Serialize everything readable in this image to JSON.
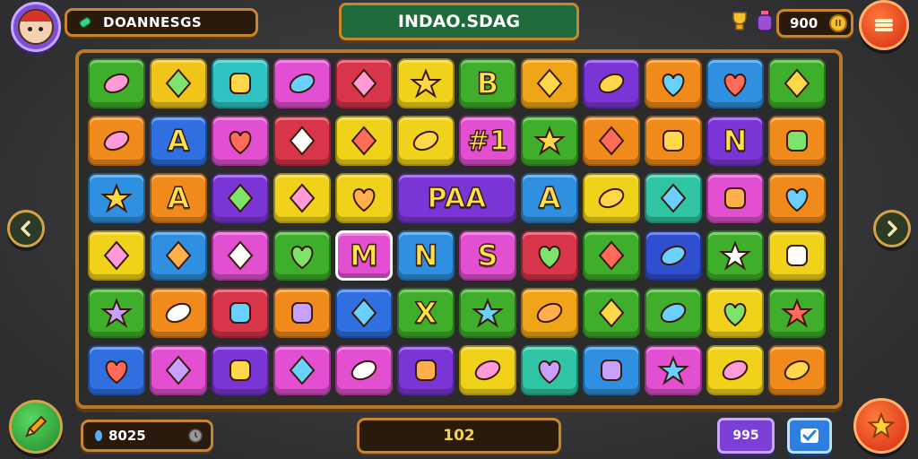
{
  "header": {
    "player_name": "DOANNESGS",
    "title": "INDAO.SDAG",
    "coins": "900"
  },
  "footer": {
    "score": "8025",
    "moves": "102",
    "counter": "995"
  },
  "colors": {
    "board_frame": "#b8782a",
    "title_green": "#1f6a3a",
    "accent_orange": "#d52a12"
  },
  "board": {
    "rows": [
      [
        {
          "color": "#3fae2a",
          "icon": "arrow-cursor-icon"
        },
        {
          "color": "#f0c419",
          "icon": "paintbrush-icon"
        },
        {
          "color": "#2fc4c4",
          "icon": "cupcake-icon"
        },
        {
          "color": "#e24fd0",
          "icon": "jar-icon"
        },
        {
          "color": "#d8344a",
          "icon": "tv-icon"
        },
        {
          "color": "#f0d21a",
          "icon": "heart-candy-icon"
        },
        {
          "color": "#3fae2a",
          "glyph": "B"
        },
        {
          "color": "#f0a418",
          "icon": "cup-icon"
        },
        {
          "color": "#7b35d6",
          "icon": "magnifier-icon"
        },
        {
          "color": "#f08a1a",
          "icon": "x-cross-icon"
        },
        {
          "color": "#2f8fe0",
          "icon": "cloud-candy-icon"
        },
        {
          "color": "#3fae2a",
          "icon": "croissant-icon"
        }
      ],
      [
        {
          "color": "#f08a1a",
          "icon": "oval-candy-icon"
        },
        {
          "color": "#2f6fe0",
          "glyph": "A"
        },
        {
          "color": "#e24fd0",
          "icon": "tack-icon"
        },
        {
          "color": "#d8344a",
          "icon": "fish-icon"
        },
        {
          "color": "#f0d21a",
          "icon": "gem-green-icon"
        },
        {
          "color": "#f0d21a",
          "icon": "leaf-icon"
        },
        {
          "color": "#e24fd0",
          "glyph": "#1"
        },
        {
          "color": "#3fae2a",
          "icon": "crayon-icon"
        },
        {
          "color": "#f08a1a",
          "icon": "roll-icon"
        },
        {
          "color": "#f08a1a",
          "icon": "steak-icon"
        },
        {
          "color": "#7b35d6",
          "glyph": "N"
        },
        {
          "color": "#f08a1a",
          "icon": "bone-icon"
        }
      ],
      [
        {
          "color": "#2f8fe0",
          "icon": "x-wrench-icon"
        },
        {
          "color": "#f08a1a",
          "glyph": "A"
        },
        {
          "color": "#7b35d6",
          "icon": "bell-pepper-icon"
        },
        {
          "color": "#f0d21a",
          "icon": "pepper-icon"
        },
        {
          "color": "#f0d21a",
          "icon": "swirl-icon"
        },
        {
          "color": "#7b35d6",
          "glyph": "PAA",
          "wide": true
        },
        {
          "color": "#2f8fe0",
          "glyph": "A"
        },
        {
          "color": "#f0d21a",
          "icon": "eggplant-icon"
        },
        {
          "color": "#2fc4a4",
          "icon": "carrot-icon"
        },
        {
          "color": "#e24fd0",
          "icon": "star-yellow-icon"
        },
        {
          "color": "#f08a1a",
          "icon": "sausage-icon"
        }
      ],
      [
        {
          "color": "#f0d21a",
          "icon": "apple-icon"
        },
        {
          "color": "#2f8fe0",
          "icon": "icecream-icon"
        },
        {
          "color": "#e24fd0",
          "icon": "gingerbread-icon"
        },
        {
          "color": "#3fae2a",
          "icon": "diamond-icon"
        },
        {
          "color": "#e24fd0",
          "glyph": "M",
          "selected": true
        },
        {
          "color": "#2f8fe0",
          "glyph": "N"
        },
        {
          "color": "#e24fd0",
          "glyph": "S"
        },
        {
          "color": "#d8344a",
          "icon": "leaf-green-icon"
        },
        {
          "color": "#3fae2a",
          "icon": "banana-icon"
        },
        {
          "color": "#2f4fd0",
          "icon": "purple-pepper-icon"
        },
        {
          "color": "#3fae2a",
          "icon": "horseshoe-icon"
        },
        {
          "color": "#f0d21a",
          "icon": "cake-icon"
        }
      ],
      [
        {
          "color": "#3fae2a",
          "icon": "star-orange-icon"
        },
        {
          "color": "#f08a1a",
          "icon": "ring-icon"
        },
        {
          "color": "#d8344a",
          "icon": "star-gold-icon"
        },
        {
          "color": "#f08a1a",
          "icon": "chili-icon"
        },
        {
          "color": "#2f6fe0",
          "icon": "horn-icon"
        },
        {
          "color": "#3fae2a",
          "glyph": "X"
        },
        {
          "color": "#3fae2a",
          "icon": "lock-icon"
        },
        {
          "color": "#f0a418",
          "icon": "drop-icon"
        },
        {
          "color": "#3fae2a",
          "icon": "star-red-icon"
        },
        {
          "color": "#3fae2a",
          "icon": "avocado-icon"
        },
        {
          "color": "#f0d21a",
          "icon": "plum-icon"
        },
        {
          "color": "#3fae2a",
          "icon": "gift-tag-icon"
        }
      ],
      [
        {
          "color": "#2f6fe0",
          "icon": "y-shape-icon"
        },
        {
          "color": "#e24fd0",
          "icon": "leaf-big-icon"
        },
        {
          "color": "#7b35d6",
          "icon": "bottle-icon"
        },
        {
          "color": "#e24fd0",
          "icon": "fries-icon"
        },
        {
          "color": "#e24fd0",
          "icon": "surfboard-icon"
        },
        {
          "color": "#7b35d6",
          "icon": "star-purple-icon"
        },
        {
          "color": "#f0d21a",
          "icon": "b-block-icon"
        },
        {
          "color": "#2fc4a4",
          "icon": "jar-green-icon"
        },
        {
          "color": "#2f8fe0",
          "icon": "cupcake-blue-icon"
        },
        {
          "color": "#e24fd0",
          "icon": "squiggle-icon"
        },
        {
          "color": "#f0d21a",
          "icon": "donut-icon"
        },
        {
          "color": "#f08a1a",
          "icon": "x-green-icon"
        }
      ]
    ]
  }
}
